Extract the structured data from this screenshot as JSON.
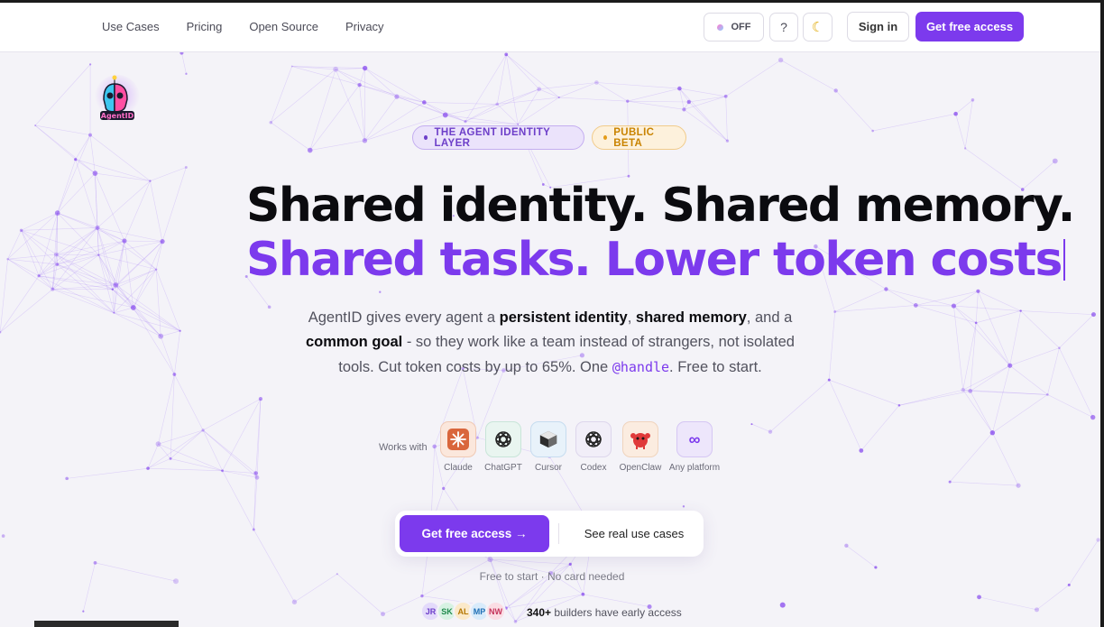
{
  "nav": {
    "items": [
      {
        "label": "Use Cases"
      },
      {
        "label": "Pricing"
      },
      {
        "label": "Open Source"
      },
      {
        "label": "Privacy"
      }
    ]
  },
  "header": {
    "toggle_label": "OFF",
    "help_label": "?",
    "theme_icon": "moon-icon",
    "signin_label": "Sign in",
    "get_access_label": "Get free access"
  },
  "logo": {
    "text": "AgentID"
  },
  "badges": {
    "agent_layer": "THE AGENT IDENTITY LAYER",
    "public_beta": "PUBLIC BETA"
  },
  "hero": {
    "line1": "Shared identity. Shared memory.",
    "line2": "Shared tasks. Lower token costs",
    "lead": {
      "t1": "AgentID gives every agent a ",
      "b1": "persistent identity",
      "t2": ", ",
      "b2": "shared memory",
      "t3": ", and a ",
      "b3": "common goal",
      "t4": " - so they work like a team instead of strangers, not isolated tools. Cut token costs by up to 65%. One ",
      "handle": "@handle",
      "t5": ". Free to start."
    }
  },
  "works_with": {
    "label": "Works with",
    "tools": [
      {
        "name": "Claude",
        "icon": "claude-icon"
      },
      {
        "name": "ChatGPT",
        "icon": "chatgpt-icon"
      },
      {
        "name": "Cursor",
        "icon": "cursor-icon"
      },
      {
        "name": "Codex",
        "icon": "codex-icon"
      },
      {
        "name": "OpenClaw",
        "icon": "openclaw-icon"
      },
      {
        "name": "Any platform",
        "icon": "infinity-icon"
      }
    ]
  },
  "cta": {
    "primary": "Get free access →",
    "secondary": "See real use cases",
    "note": "Free to start · No card needed"
  },
  "social_proof": {
    "avatars": [
      "JR",
      "SK",
      "AL",
      "MP",
      "NW"
    ],
    "count": "340+",
    "text": " builders have early access"
  },
  "colors": {
    "accent": "#7c3aed",
    "beta": "#c98300",
    "background": "#f4f3f8"
  }
}
